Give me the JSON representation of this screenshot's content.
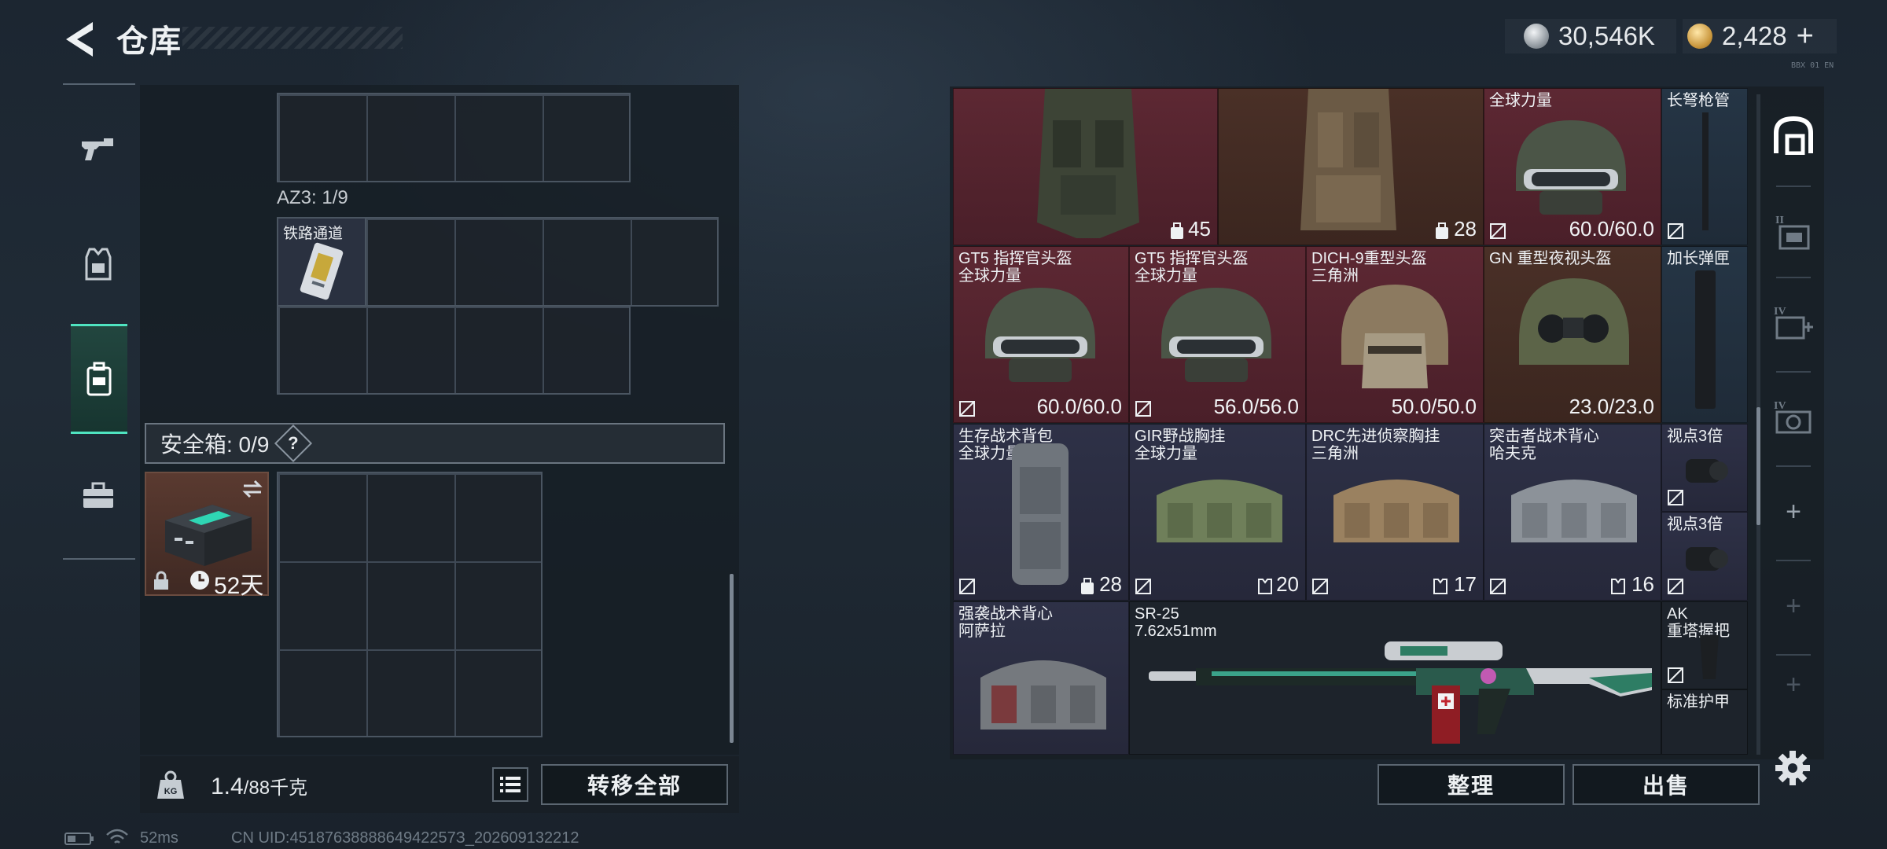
{
  "header": {
    "title": "仓库",
    "currency_silver": "30,546K",
    "currency_gold": "2,428",
    "add_label": "+",
    "corner_code": "BBX 01 EN"
  },
  "left_rail": {
    "items": [
      "gun-icon",
      "armor-icon",
      "backpack-icon",
      "briefcase-icon"
    ],
    "active_index": 2
  },
  "containers": {
    "az3_label": "AZ3: 1/9",
    "item_railway_label": "铁路通道",
    "safe_box_label": "安全箱: 0/9",
    "safe_box_help": "?",
    "safe_box_item_days": "52天"
  },
  "bottom_left": {
    "weight_current": "1.4",
    "weight_max": "/88千克",
    "transfer_all": "转移全部"
  },
  "status": {
    "ping": "52ms",
    "uid": "CN UID:4518763888864942257З_202609132212"
  },
  "stash": {
    "row0": [
      {
        "value": "45"
      },
      {
        "value": "28"
      },
      {
        "name": "全球力量",
        "value": "60.0/60.0"
      },
      {
        "name": "长弩枪管"
      }
    ],
    "row1": [
      {
        "name": "GT5 指挥官头盔",
        "sub": "全球力量",
        "value": "60.0/60.0"
      },
      {
        "name": "GT5 指挥官头盔",
        "sub": "全球力量",
        "value": "56.0/56.0"
      },
      {
        "name": "DICH-9重型头盔",
        "sub": "三角洲",
        "value": "50.0/50.0"
      },
      {
        "name": "GN 重型夜视头盔",
        "sub": "",
        "value": "23.0/23.0"
      },
      {
        "name": "加长弹匣"
      }
    ],
    "row2": [
      {
        "name": "生存战术背包",
        "sub": "全球力量",
        "value": "28"
      },
      {
        "name": "GIR野战胸挂",
        "sub": "全球力量",
        "value": "20"
      },
      {
        "name": "DRC先进侦察胸挂",
        "sub": "三角洲",
        "value": "17"
      },
      {
        "name": "突击者战术背心",
        "sub": "哈夫克",
        "value": "16"
      },
      {
        "name": "视点3倍"
      },
      {
        "name": "视点3倍"
      }
    ],
    "row3": [
      {
        "name": "强袭战术背心",
        "sub": "阿萨拉"
      },
      {
        "name": "SR-25",
        "sub": "7.62x51mm"
      },
      {
        "name": "AK",
        "sub": "重塔握把"
      },
      {
        "name": "标准护甲"
      }
    ]
  },
  "bottom_right": {
    "sort": "整理",
    "sell": "出售"
  },
  "right_rail": {
    "items": [
      "stash-home-icon",
      "tab-II-icon",
      "tab-IV-medkit-icon",
      "tab-IV-camera-icon",
      "add-tab-icon",
      "add-tab-icon",
      "add-tab-icon"
    ],
    "plus": "+"
  },
  "colors": {
    "accent": "#4fe3c0",
    "rarity_red": "#5d2833",
    "rarity_purple": "#2e3147",
    "rarity_brown": "#4a3027"
  }
}
